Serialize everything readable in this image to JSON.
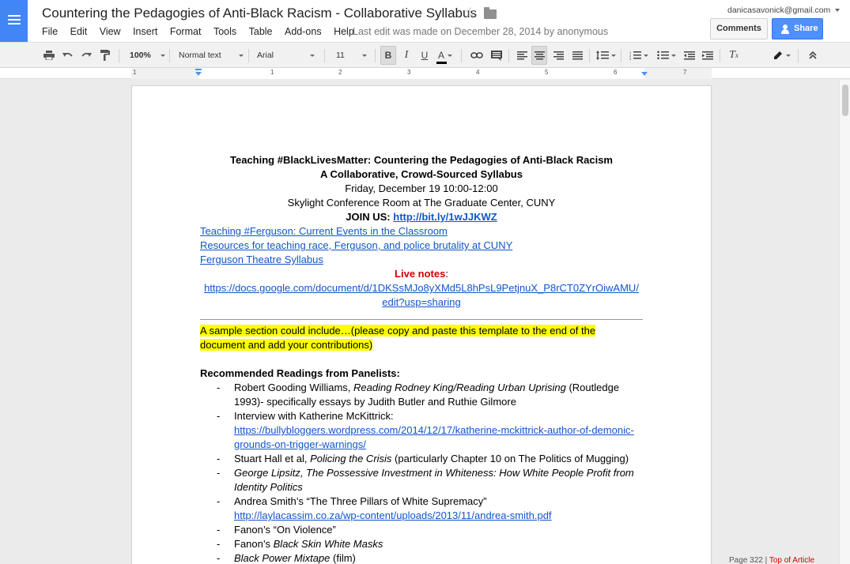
{
  "header": {
    "title": "Countering the Pedagogies of Anti-Black Racism - Collaborative Syllabus",
    "menu": [
      "File",
      "Edit",
      "View",
      "Insert",
      "Format",
      "Tools",
      "Table",
      "Add-ons",
      "Help"
    ],
    "last_edit": "Last edit was made on December 28, 2014 by anonymous",
    "account": "danicasavonick@gmail.com",
    "comments_label": "Comments",
    "share_label": "Share"
  },
  "toolbar": {
    "zoom": "100%",
    "style": "Normal text",
    "font": "Arial",
    "size": "11"
  },
  "ruler": {
    "numbers": [
      "1",
      "1",
      "2",
      "3",
      "4",
      "5",
      "6",
      "7"
    ]
  },
  "document": {
    "heading1": "Teaching #BlackLivesMatter: Countering the Pedagogies of Anti-Black Racism",
    "heading2": "A Collaborative, Crowd-Sourced Syllabus",
    "date_line": "Friday, December 19 10:00-12:00",
    "location_line": "Skylight Conference Room at The Graduate Center, CUNY",
    "join_label": "JOIN US: ",
    "join_link": "http://bit.ly/1wJJKWZ",
    "links": [
      "Teaching #Ferguson: Current Events in the Classroom",
      "Resources for teaching race, Ferguson, and police brutality at CUNY",
      "Ferguson Theatre Syllabus"
    ],
    "live_notes_label": "Live notes",
    "live_notes_colon": ":",
    "live_notes_url_1": "https://docs.google.com/document/d/1DKSsMJo8yXMd5L8hPsL9PetjnuX_P8rCT0ZYrOiwAMU/",
    "live_notes_url_2": "edit?usp=sharing",
    "sample_section_1": "A sample section could include…(please copy and paste this template to the end of the",
    "sample_section_2": "document and add your contributions)",
    "readings_heading": "Recommended Readings from Panelists:",
    "readings": {
      "r1_a": "Robert Gooding Williams, ",
      "r1_b": "Reading Rodney King/Reading Urban Uprising",
      "r1_c": " (Routledge",
      "r1_d": "1993)- specifically essays by Judith Butler and Ruthie Gilmore",
      "r2_a": "Interview with Katherine McKittrick:",
      "r2_link_1": "https://bullybloggers.wordpress.com/2014/12/17/katherine-mckittrick-author-of-demonic-",
      "r2_link_2": "grounds-on-trigger-warnings/",
      "r3_a": "Stuart Hall et al, ",
      "r3_b": "Policing the Crisis",
      "r3_c": " (particularly Chapter 10 on The Politics of Mugging)",
      "r4_a": "George Lipsitz, The Possessive Investment in Whiteness: How White People Profit from",
      "r4_b": "Identity Politics",
      "r5_a": "Andrea Smith’s “The Three Pillars of White Supremacy”",
      "r5_link": "http://laylacassim.co.za/wp-content/uploads/2013/11/andrea-smith.pdf",
      "r6_a": "Fanon’s “On Violence”",
      "r7_a": "Fanon’s ",
      "r7_b": "Black Skin White Masks",
      "r8_a": "Black Power Mixtape",
      "r8_b": " (film)"
    }
  },
  "bottom_badge": {
    "page": "Page 322",
    "sep": " | ",
    "link": "Top of Article"
  },
  "colors": {
    "accent_blue": "#4285f4",
    "share_blue": "#4d90fe",
    "link_blue": "#1155cc",
    "live_notes_red": "#cc0000",
    "highlight_yellow": "#ffff00"
  }
}
